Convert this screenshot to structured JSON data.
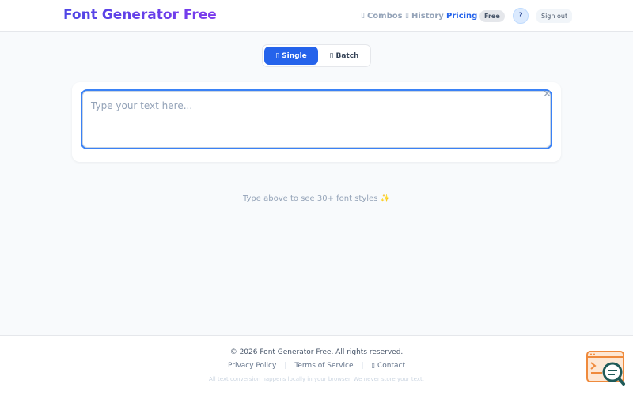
{
  "header": {
    "brand": "Font Generator Free",
    "nav": {
      "combos": {
        "icon": "combos-icon",
        "label": "Combos"
      },
      "history": {
        "icon": "history-icon",
        "label": "History"
      },
      "pricing": "Pricing",
      "plan_badge": "Free",
      "help": "?",
      "signout": "Sign out"
    }
  },
  "mode_toggle": {
    "single": {
      "icon": "single-icon",
      "label": "Single"
    },
    "batch": {
      "icon": "batch-icon",
      "label": "Batch"
    },
    "active": "single"
  },
  "input": {
    "placeholder": "Type your text here...",
    "value": "",
    "clear_icon": "close-icon"
  },
  "hint": "Type above to see 30+ font styles ✨",
  "footer": {
    "copyright": "© 2026 Font Generator Free. All rights reserved.",
    "links": {
      "privacy": "Privacy Policy",
      "terms": "Terms of Service",
      "contact": "Contact"
    },
    "separator": "|",
    "note": "All text conversion happens locally in your browser. We never store your text."
  },
  "colors": {
    "accent": "#2563eb",
    "brand_start": "#4f46e5",
    "brand_end": "#7c3aed",
    "focus_border": "#3b82f6"
  }
}
